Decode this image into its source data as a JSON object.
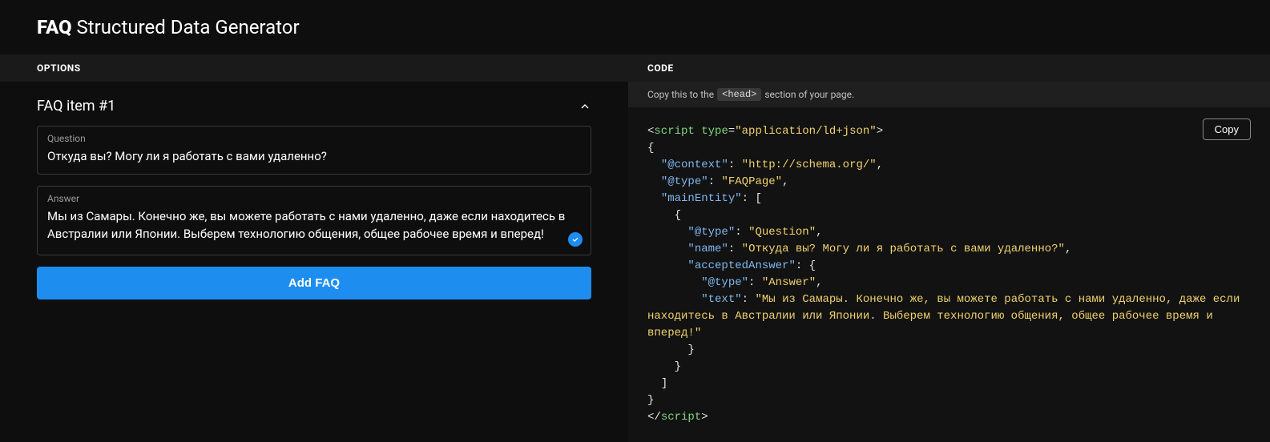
{
  "header": {
    "title_bold": "FAQ",
    "title_rest": "Structured Data Generator"
  },
  "left": {
    "head": "OPTIONS",
    "faq_item_title": "FAQ item #1",
    "question_label": "Question",
    "question_value": "Откуда вы? Могу ли я работать с вами удаленно?",
    "answer_label": "Answer",
    "answer_value": "Мы из Самары. Конечно же, вы можете работать с нами удаленно, даже если находитесь в Австралии или Японии. Выберем технологию общения, общее рабочее время и вперед!",
    "add_button": "Add FAQ"
  },
  "right": {
    "head": "CODE",
    "subhead_prefix": "Copy this to the",
    "subhead_chip": "<head>",
    "subhead_suffix": "section of your page.",
    "copy_button": "Copy",
    "json_ld": {
      "context_key": "@context",
      "context_val": "http://schema.org/",
      "type_key": "@type",
      "type_val": "FAQPage",
      "main_key": "mainEntity",
      "q_type_key": "@type",
      "q_type_val": "Question",
      "q_name_key": "name",
      "q_name_val": "Откуда вы? Могу ли я работать с вами удаленно?",
      "aa_key": "acceptedAnswer",
      "a_type_key": "@type",
      "a_type_val": "Answer",
      "a_text_key": "text",
      "a_text_val": "Мы из Самары. Конечно же, вы можете работать с нами удаленно, даже если находитесь в Австралии или Японии. Выберем технологию общения, общее рабочее время и вперед!",
      "script_tag": "script",
      "script_attr": "type",
      "script_attr_val": "application/ld+json"
    }
  }
}
